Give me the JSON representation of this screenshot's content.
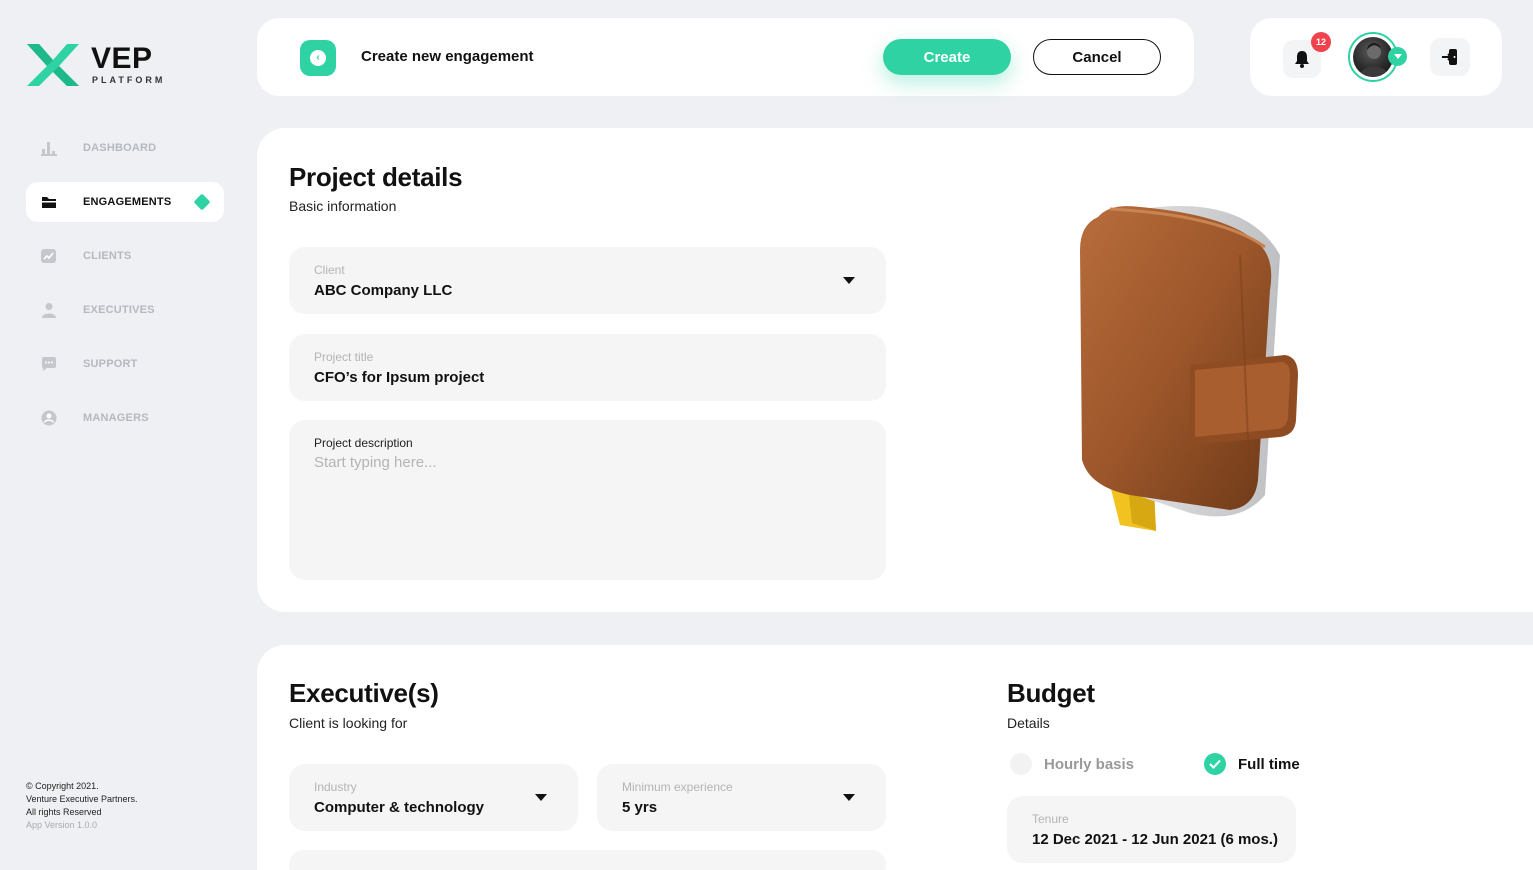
{
  "brand": {
    "title": "VEP",
    "subtitle": "PLATFORM"
  },
  "sidebar": {
    "items": [
      {
        "label": "DASHBOARD",
        "icon": "chart-icon",
        "active": false
      },
      {
        "label": "ENGAGEMENTS",
        "icon": "folder-icon",
        "active": true
      },
      {
        "label": "CLIENTS",
        "icon": "clients-icon",
        "active": false
      },
      {
        "label": "EXECUTIVES",
        "icon": "person-icon",
        "active": false
      },
      {
        "label": "SUPPORT",
        "icon": "chat-icon",
        "active": false
      },
      {
        "label": "MANAGERS",
        "icon": "account-icon",
        "active": false
      }
    ],
    "copyright": {
      "line1": "© Copyright 2021.",
      "line2": "Venture Executive Partners.",
      "line3": "All rights Reserved",
      "version": "App Version 1.0.0"
    }
  },
  "topbar": {
    "title": "Create new engagement",
    "create_label": "Create",
    "cancel_label": "Cancel"
  },
  "userbar": {
    "notification_count": "12"
  },
  "project": {
    "title": "Project details",
    "subtitle": "Basic information",
    "client": {
      "label": "Client",
      "value": "ABC Company LLC"
    },
    "project_title": {
      "label": "Project title",
      "value": "CFO’s for Ipsum project"
    },
    "description": {
      "label": "Project description",
      "placeholder": "Start typing here..."
    }
  },
  "executives": {
    "title": "Executive(s)",
    "subtitle": "Client is looking for",
    "industry": {
      "label": "Industry",
      "value": "Computer & technology"
    },
    "experience": {
      "label": "Minimum experience",
      "value": "5 yrs"
    }
  },
  "budget": {
    "title": "Budget",
    "subtitle": "Details",
    "options": [
      {
        "label": "Hourly basis",
        "selected": false
      },
      {
        "label": "Full time",
        "selected": true
      }
    ],
    "tenure": {
      "label": "Tenure",
      "value": "12 Dec 2021 - 12 Jun 2021 (6 mos.)"
    }
  },
  "colors": {
    "accent": "#2fd3a3",
    "badge": "#f0424c",
    "background": "#eef0f3"
  }
}
